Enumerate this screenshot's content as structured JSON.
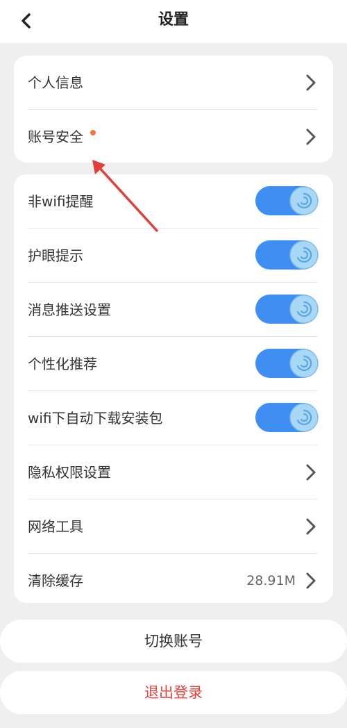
{
  "header": {
    "title": "设置"
  },
  "account_card": {
    "items": [
      {
        "label": "个人信息"
      },
      {
        "label": "账号安全"
      }
    ]
  },
  "settings_card": {
    "toggles": [
      {
        "label": "非wifi提醒",
        "on": true
      },
      {
        "label": "护眼提示",
        "on": true
      },
      {
        "label": "消息推送设置",
        "on": true
      },
      {
        "label": "个性化推荐",
        "on": true
      },
      {
        "label": "wifi下自动下载安装包",
        "on": true
      }
    ],
    "links": [
      {
        "label": "隐私权限设置"
      },
      {
        "label": "网络工具"
      },
      {
        "label": "清除缓存",
        "value": "28.91M"
      }
    ]
  },
  "buttons": {
    "switch_account": "切换账号",
    "logout": "退出登录"
  },
  "colors": {
    "toggle_on": "#3f8ff2",
    "notification_dot": "#ee7744",
    "logout_text": "#e2443a",
    "annotation_arrow": "#e0403a"
  }
}
